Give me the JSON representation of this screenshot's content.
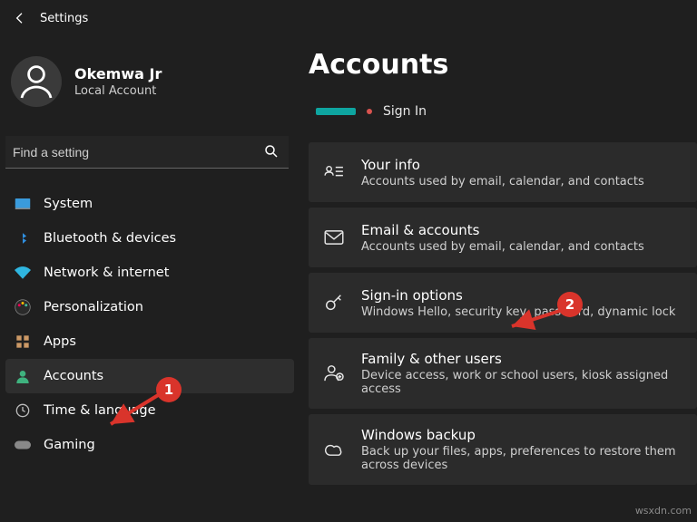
{
  "app": {
    "title": "Settings"
  },
  "user": {
    "name": "Okemwa Jr",
    "sub": "Local Account"
  },
  "search": {
    "placeholder": "Find a setting"
  },
  "nav": [
    {
      "label": "System"
    },
    {
      "label": "Bluetooth & devices"
    },
    {
      "label": "Network & internet"
    },
    {
      "label": "Personalization"
    },
    {
      "label": "Apps"
    },
    {
      "label": "Accounts"
    },
    {
      "label": "Time & language"
    },
    {
      "label": "Gaming"
    }
  ],
  "main": {
    "title": "Accounts",
    "signin_label": "Sign In",
    "cards": [
      {
        "title": "Your info",
        "sub": "Accounts used by email, calendar, and contacts"
      },
      {
        "title": "Email & accounts",
        "sub": "Accounts used by email, calendar, and contacts"
      },
      {
        "title": "Sign-in options",
        "sub": "Windows Hello, security key, password, dynamic lock"
      },
      {
        "title": "Family & other users",
        "sub": "Device access, work or school users, kiosk assigned access"
      },
      {
        "title": "Windows backup",
        "sub": "Back up your files, apps, preferences to restore them across devices"
      }
    ]
  },
  "annotations": {
    "one": "1",
    "two": "2"
  },
  "watermark": "wsxdn.com"
}
